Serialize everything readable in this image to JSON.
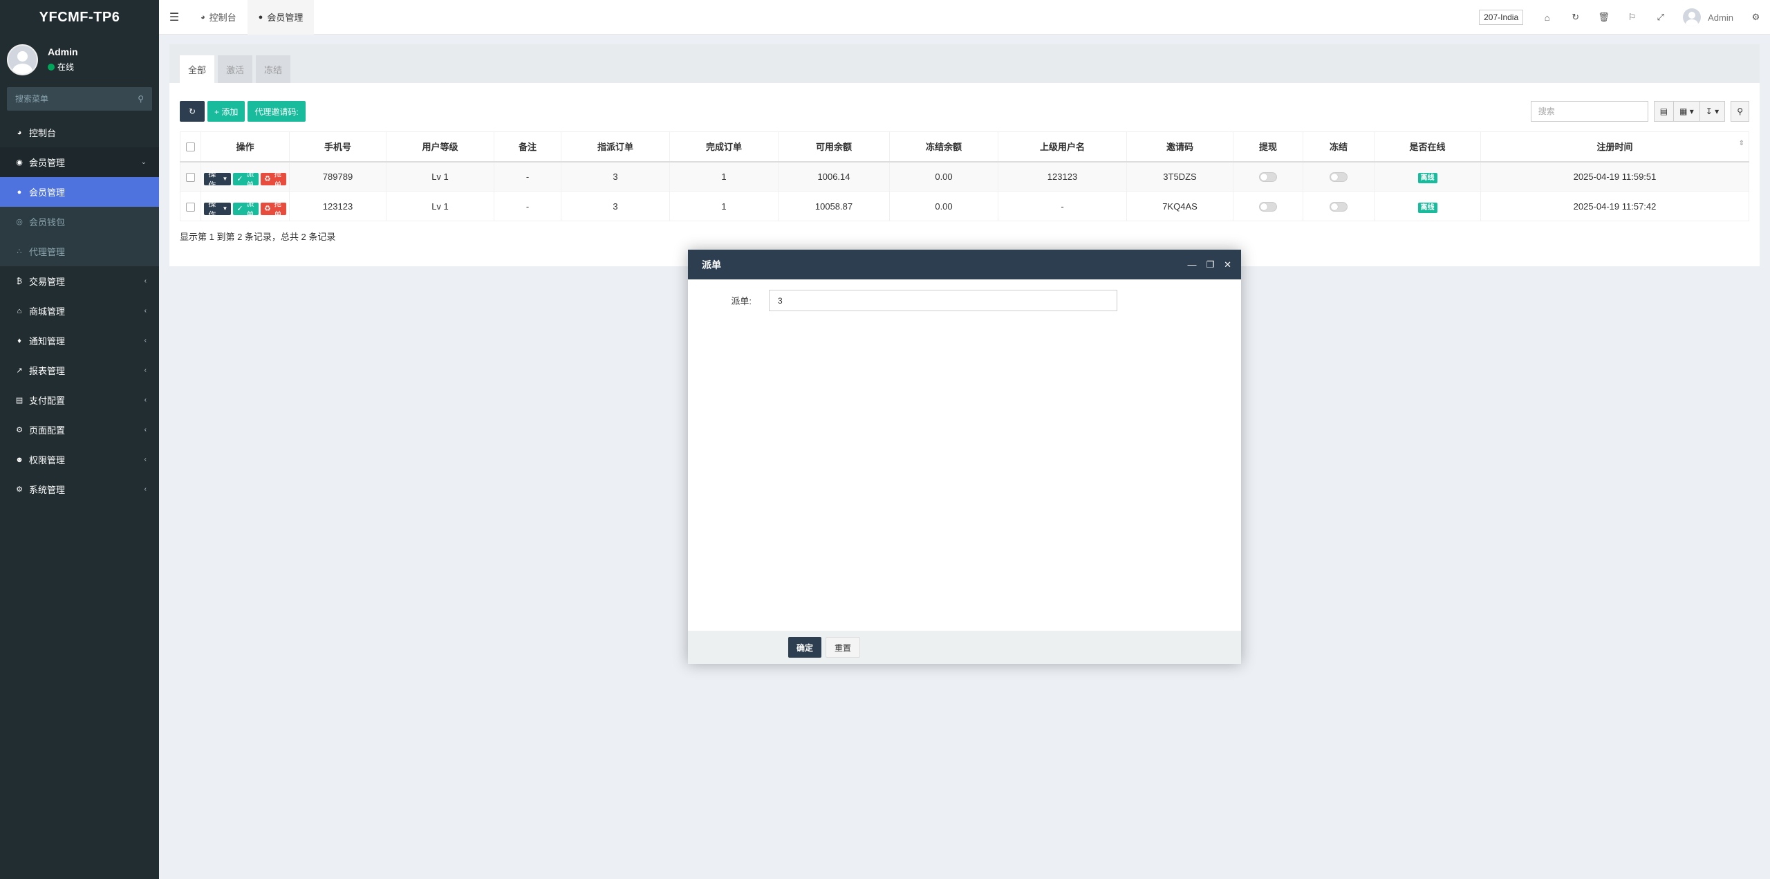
{
  "app": {
    "logo": "YFCMF-TP6"
  },
  "user": {
    "name": "Admin",
    "status": "在线"
  },
  "sidebar": {
    "search_placeholder": "搜索菜单",
    "items": [
      {
        "label": "控制台",
        "icon": "dashboard-icon"
      },
      {
        "label": "会员管理",
        "icon": "user-circle-icon",
        "open": true
      },
      {
        "label": "交易管理",
        "icon": "bitcoin-icon"
      },
      {
        "label": "商城管理",
        "icon": "home-icon"
      },
      {
        "label": "通知管理",
        "icon": "bell-icon"
      },
      {
        "label": "报表管理",
        "icon": "line-chart-icon"
      },
      {
        "label": "支付配置",
        "icon": "credit-card-icon"
      },
      {
        "label": "页面配置",
        "icon": "gear-icon"
      },
      {
        "label": "权限管理",
        "icon": "users-icon"
      },
      {
        "label": "系统管理",
        "icon": "cogs-icon"
      }
    ],
    "sub_items": [
      {
        "label": "会员管理",
        "icon": "user-icon",
        "active": true
      },
      {
        "label": "会员钱包",
        "icon": "wallet-icon"
      },
      {
        "label": "代理管理",
        "icon": "sitemap-icon"
      }
    ]
  },
  "header": {
    "tabs": [
      {
        "label": "控制台",
        "icon": "dashboard-icon"
      },
      {
        "label": "会员管理",
        "icon": "user-icon",
        "active": true
      }
    ],
    "version_badge": "207-India",
    "user_name": "Admin"
  },
  "panel": {
    "tabs": [
      "全部",
      "激活",
      "冻结"
    ],
    "toolbar": {
      "add_label": "+ 添加",
      "invite_label": "代理邀请码:",
      "search_placeholder": "搜索"
    },
    "columns": [
      "操作",
      "手机号",
      "用户等级",
      "备注",
      "指派订单",
      "完成订单",
      "可用余额",
      "冻结余额",
      "上级用户名",
      "邀请码",
      "提现",
      "冻结",
      "是否在线",
      "注册时间"
    ],
    "row_action": {
      "ops": "操作",
      "dispatch": "派单",
      "grab": "抢单"
    },
    "rows": [
      {
        "phone": "789789",
        "level": "Lv 1",
        "remark": "-",
        "assigned": "3",
        "done": "1",
        "balance": "1006.14",
        "frozen": "0.00",
        "parent": "123123",
        "invite": "3T5DZS",
        "online": "离线",
        "time": "2025-04-19 11:59:51"
      },
      {
        "phone": "123123",
        "level": "Lv 1",
        "remark": "-",
        "assigned": "3",
        "done": "1",
        "balance": "10058.87",
        "frozen": "0.00",
        "parent": "-",
        "invite": "7KQ4AS",
        "online": "离线",
        "time": "2025-04-19 11:57:42"
      }
    ],
    "pager_text": "显示第 1 到第 2 条记录，总共 2 条记录"
  },
  "modal": {
    "title": "派单",
    "field_label": "派单:",
    "field_value": "3",
    "confirm_label": "确定",
    "reset_label": "重置"
  }
}
